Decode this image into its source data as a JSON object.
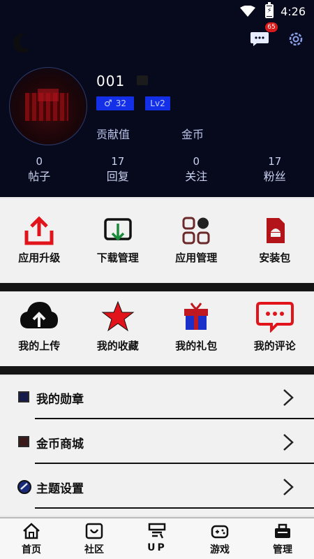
{
  "status_bar": {
    "time": "4:26"
  },
  "header": {
    "message_badge": "65",
    "username": "001",
    "gender_value": "32",
    "level": "Lv2",
    "contribution_label": "贡献值",
    "gold_label": "金币",
    "stats": [
      {
        "value": "0",
        "label": "帖子"
      },
      {
        "value": "17",
        "label": "回复"
      },
      {
        "value": "0",
        "label": "关注"
      },
      {
        "value": "17",
        "label": "粉丝"
      }
    ]
  },
  "app_grid": [
    {
      "label": "应用升级",
      "icon": "upload-icon"
    },
    {
      "label": "下载管理",
      "icon": "download-icon"
    },
    {
      "label": "应用管理",
      "icon": "apps-icon"
    },
    {
      "label": "安装包",
      "icon": "apk-icon"
    }
  ],
  "my_grid": [
    {
      "label": "我的上传",
      "icon": "cloud-upload-icon"
    },
    {
      "label": "我的收藏",
      "icon": "star-icon"
    },
    {
      "label": "我的礼包",
      "icon": "gift-icon"
    },
    {
      "label": "我的评论",
      "icon": "comment-icon"
    }
  ],
  "list": [
    {
      "label": "我的勋章",
      "icon": "medal-icon"
    },
    {
      "label": "金币商城",
      "icon": "shop-icon"
    },
    {
      "label": "主题设置",
      "icon": "theme-icon"
    }
  ],
  "bottom_nav": [
    {
      "label": "首页",
      "icon": "home-icon"
    },
    {
      "label": "社区",
      "icon": "community-icon"
    },
    {
      "label": "UP",
      "icon": "up-icon"
    },
    {
      "label": "游戏",
      "icon": "gamepad-icon"
    },
    {
      "label": "管理",
      "icon": "manage-icon",
      "active": true
    }
  ],
  "colors": {
    "header_bg": "#070a1c",
    "accent_blue": "#1330e8",
    "accent_red": "#e0141a",
    "badge_red": "#d71a1a"
  }
}
